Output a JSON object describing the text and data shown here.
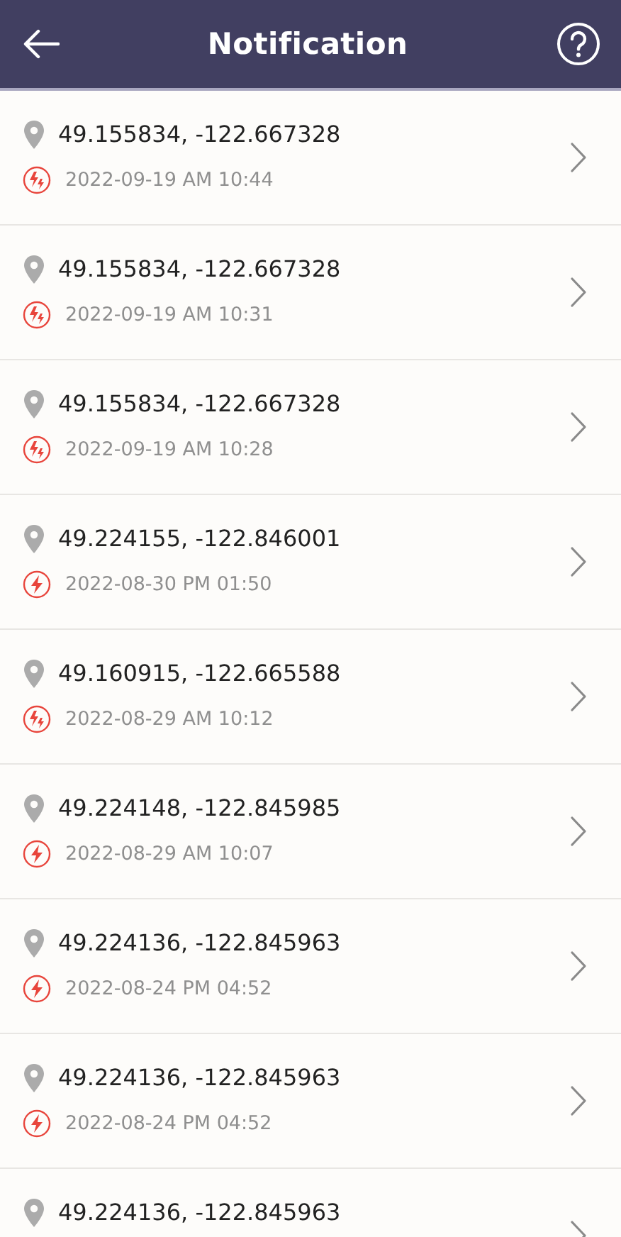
{
  "header": {
    "title": "Notification"
  },
  "notifications": [
    {
      "coordinates": "49.155834, -122.667328",
      "time": "2022-09-19 AM 10:44",
      "kind": "double"
    },
    {
      "coordinates": "49.155834, -122.667328",
      "time": "2022-09-19 AM 10:31",
      "kind": "double"
    },
    {
      "coordinates": "49.155834, -122.667328",
      "time": "2022-09-19 AM 10:28",
      "kind": "double"
    },
    {
      "coordinates": "49.224155, -122.846001",
      "time": "2022-08-30 PM 01:50",
      "kind": "single"
    },
    {
      "coordinates": "49.160915, -122.665588",
      "time": "2022-08-29 AM 10:12",
      "kind": "double"
    },
    {
      "coordinates": "49.224148, -122.845985",
      "time": "2022-08-29 AM 10:07",
      "kind": "single"
    },
    {
      "coordinates": "49.224136, -122.845963",
      "time": "2022-08-24 PM 04:52",
      "kind": "single"
    },
    {
      "coordinates": "49.224136, -122.845963",
      "time": "2022-08-24 PM 04:52",
      "kind": "single"
    },
    {
      "coordinates": "49.224136, -122.845963"
    }
  ]
}
